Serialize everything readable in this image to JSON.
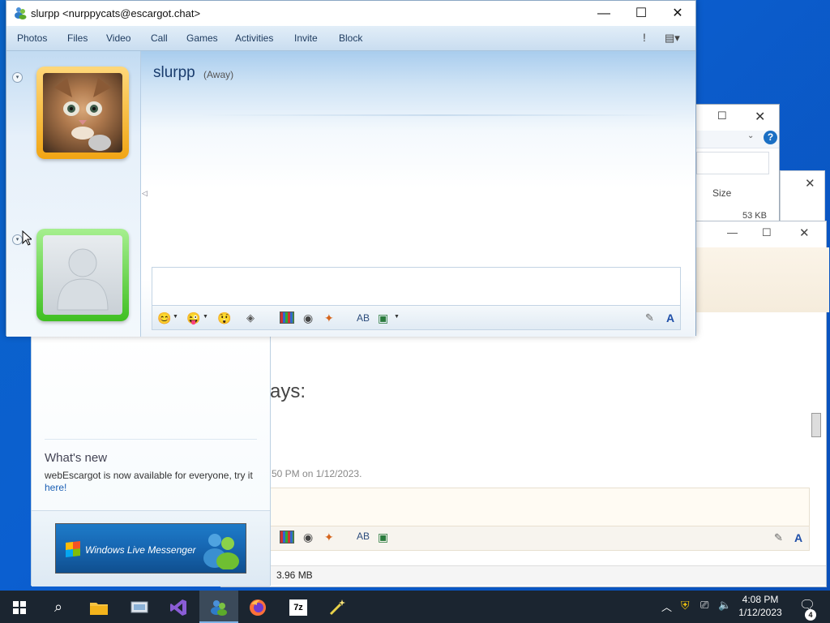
{
  "main_window": {
    "title": "slurpp <nurppycats@escargot.chat>",
    "menu": [
      "Photos",
      "Files",
      "Video",
      "Call",
      "Games",
      "Activities",
      "Invite",
      "Block"
    ],
    "buddy_name": "slurpp",
    "buddy_status": "(Away)"
  },
  "contacts_window": {
    "whats_new_heading": "What's new",
    "whats_new_text": "webEscargot is now available for everyone, try it",
    "whats_new_link": "here!",
    "banner_text": "Windows Live Messenger"
  },
  "chat2_window": {
    "partial_says": "ays:",
    "partial_timestamp": "50 PM on 1/12/2023."
  },
  "explorer_window": {
    "column_size": "Size",
    "file_size": "53 KB",
    "status_size": "3.96 MB"
  },
  "taskbar": {
    "time": "4:08 PM",
    "date": "1/12/2023",
    "notification_count": "4"
  },
  "colors": {
    "accent": "#1a6fc4",
    "menu_text": "#1d3a5e",
    "buddy_name": "#1a3d6e",
    "link": "#1a5fb4",
    "taskbar": "#1b2530"
  }
}
